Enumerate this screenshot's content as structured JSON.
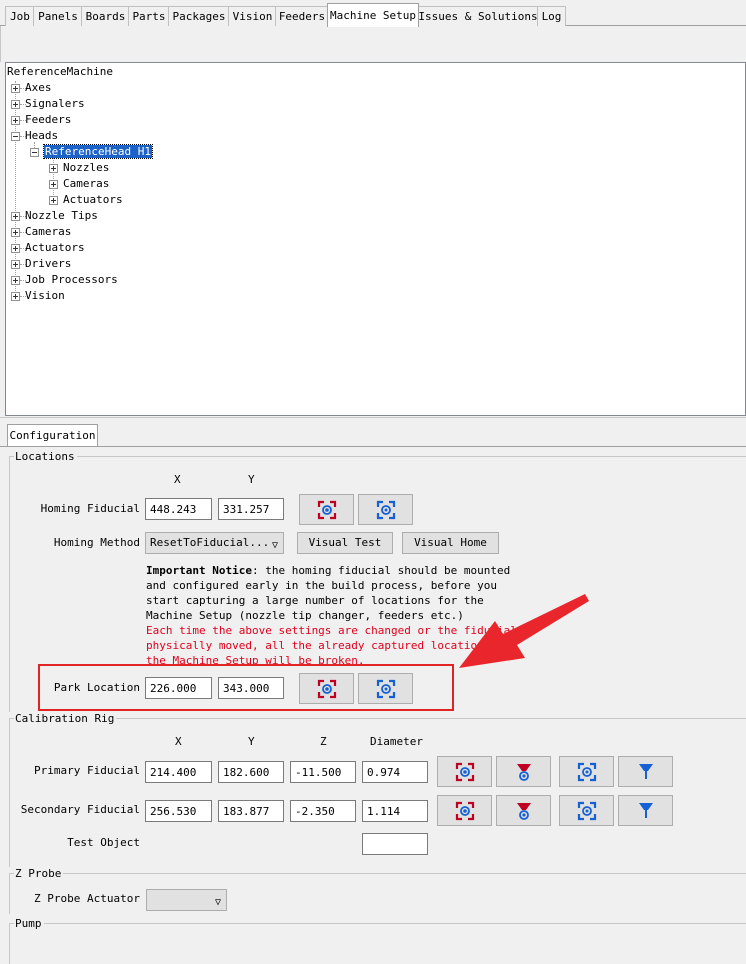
{
  "tabs": [
    {
      "label": "Job",
      "active": false
    },
    {
      "label": "Panels",
      "active": false
    },
    {
      "label": "Boards",
      "active": false
    },
    {
      "label": "Parts",
      "active": false
    },
    {
      "label": "Packages",
      "active": false
    },
    {
      "label": "Vision",
      "active": false
    },
    {
      "label": "Feeders",
      "active": false
    },
    {
      "label": "Machine Setup",
      "active": true
    },
    {
      "label": "Issues & Solutions",
      "active": false
    },
    {
      "label": "Log",
      "active": false
    }
  ],
  "tree": {
    "root": "ReferenceMachine",
    "items": [
      "Axes",
      "Signalers",
      "Feeders",
      "Heads",
      "Nozzle Tips",
      "Cameras",
      "Actuators",
      "Drivers",
      "Job Processors",
      "Vision"
    ],
    "head": {
      "label": "ReferenceHead H1",
      "children": [
        "Nozzles",
        "Cameras",
        "Actuators"
      ]
    }
  },
  "config_tab": "Configuration",
  "locations": {
    "title": "Locations",
    "col_x": "X",
    "col_y": "Y",
    "homing_fiducial": {
      "label": "Homing Fiducial",
      "x": "448.243",
      "y": "331.257"
    },
    "homing_method": {
      "label": "Homing Method",
      "value": "ResetToFiducial...",
      "visual_test": "Visual Test",
      "visual_home": "Visual Home"
    },
    "notice": {
      "bold": "Important Notice",
      "line1_rest": ": the homing fiducial should be mounted",
      "lines": [
        "and configured early in the build process, before you",
        "start capturing a large number of locations for the",
        "Machine Setup (nozzle tip changer, feeders etc.)"
      ],
      "warning": [
        "Each time the above settings are changed or the fiducial",
        "physically moved, all the already captured locations in",
        "the Machine Setup will be broken."
      ]
    },
    "park": {
      "label": "Park Location",
      "x": "226.000",
      "y": "343.000"
    }
  },
  "calibration": {
    "title": "Calibration Rig",
    "col_x": "X",
    "col_y": "Y",
    "col_z": "Z",
    "col_diameter": "Diameter",
    "primary": {
      "label": "Primary Fiducial",
      "x": "214.400",
      "y": "182.600",
      "z": "-11.500",
      "diameter": "0.974"
    },
    "secondary": {
      "label": "Secondary Fiducial",
      "x": "256.530",
      "y": "183.877",
      "z": "-2.350",
      "diameter": "1.114"
    },
    "test_object": {
      "label": "Test Object",
      "value": ""
    }
  },
  "zprobe": {
    "title": "Z Probe",
    "actuator_label": "Z Probe Actuator",
    "actuator_value": ""
  },
  "pump": {
    "title": "Pump"
  },
  "colors": {
    "accent": "#1c62c7",
    "capture_red": "#c00020",
    "capture_blue": "#1560d4",
    "callout": "#e02424"
  },
  "icons": {
    "capture_camera": "capture-camera-icon",
    "position_camera": "position-camera-icon",
    "capture_nozzle": "capture-nozzle-icon",
    "position_nozzle": "position-nozzle-icon"
  }
}
